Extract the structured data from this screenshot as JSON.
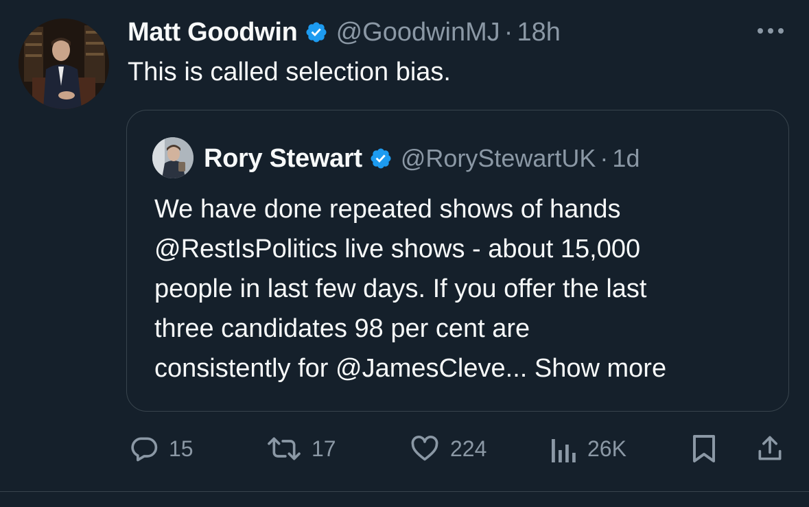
{
  "tweet": {
    "author_name": "Matt Goodwin",
    "author_handle": "@GoodwinMJ",
    "separator": "·",
    "time": "18h",
    "text": "This is called selection bias."
  },
  "quote": {
    "author_name": "Rory Stewart",
    "author_handle": "@RoryStewartUK",
    "separator": "·",
    "time": "1d",
    "lines": [
      "We have done repeated shows of hands",
      "@RestIsPolitics live shows - about 15,000",
      "people in last few days. If you offer the last",
      "three candidates 98 per cent are",
      "consistently for @JamesCleve..."
    ],
    "show_more": "Show more"
  },
  "actions": {
    "replies": "15",
    "reposts": "17",
    "likes": "224",
    "views": "26K"
  },
  "icons": {
    "verified": "verified-badge-icon",
    "more": "more-options-icon",
    "reply": "reply-icon",
    "repost": "repost-icon",
    "like": "heart-icon",
    "views": "views-icon",
    "bookmark": "bookmark-icon",
    "share": "share-icon"
  },
  "colors": {
    "background": "#15202b",
    "text": "#f7f9f9",
    "secondary": "#8b98a5",
    "verified": "#1d9bf0",
    "border": "#38444d"
  }
}
